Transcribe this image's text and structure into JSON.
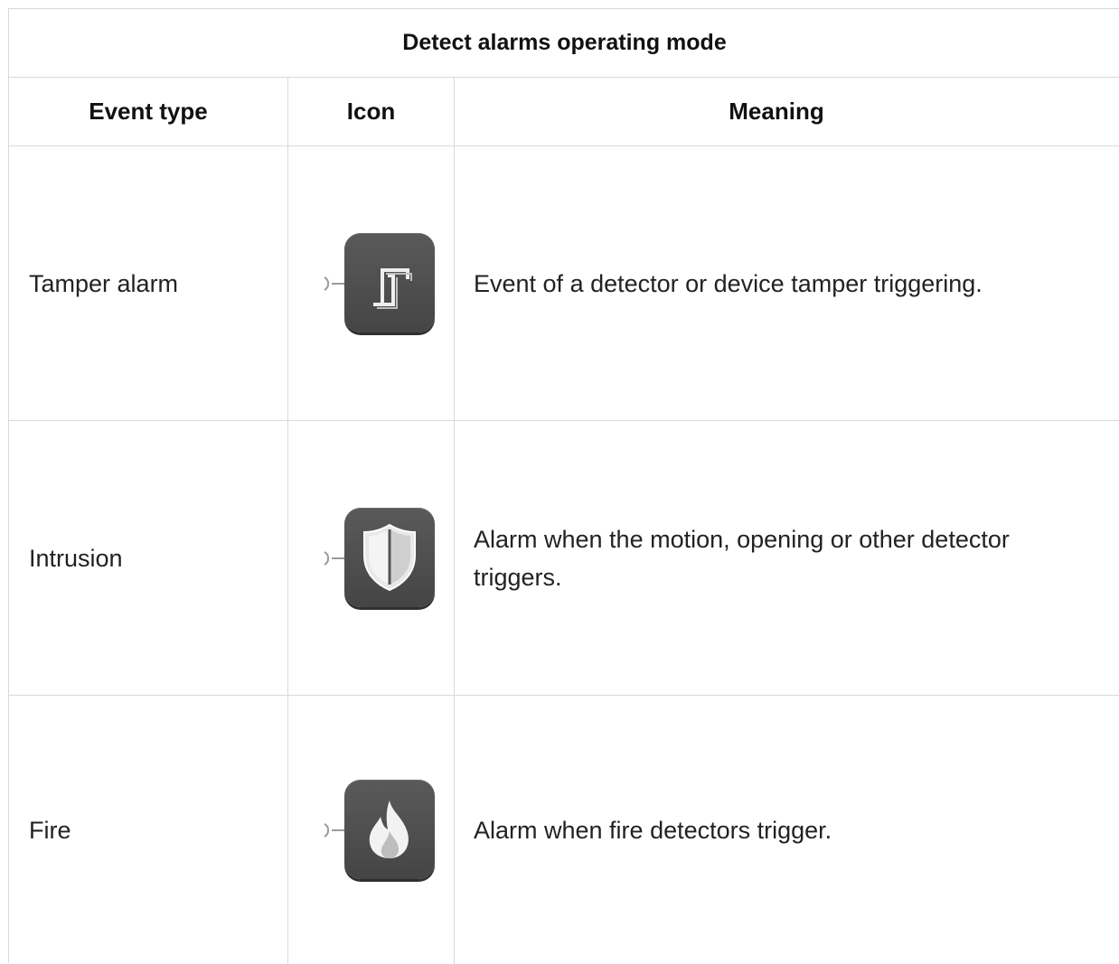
{
  "table": {
    "title": "Detect alarms operating mode",
    "headers": {
      "event_type": "Event type",
      "icon": "Icon",
      "meaning": "Meaning"
    },
    "rows": [
      {
        "event_type": "Tamper alarm",
        "icon": "tamper-icon",
        "meaning": "Event of a detector or device tamper triggering."
      },
      {
        "event_type": "Intrusion",
        "icon": "shield-icon",
        "meaning": "Alarm when the motion, opening or other detector triggers."
      },
      {
        "event_type": "Fire",
        "icon": "flame-icon",
        "meaning": "Alarm when fire detectors trigger."
      }
    ]
  },
  "colors": {
    "border": "#d9d9d9",
    "icon_tile": "#4f4f4f",
    "icon_glyph": "#eeeeee"
  }
}
